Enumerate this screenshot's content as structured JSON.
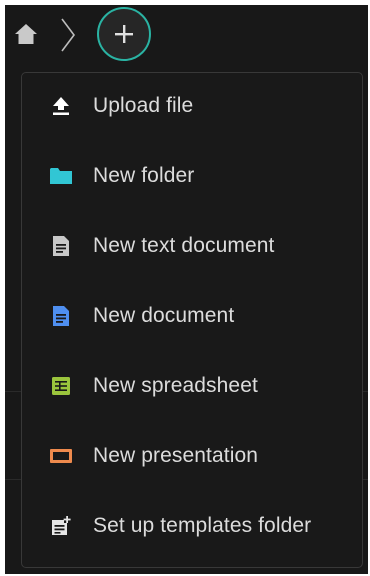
{
  "colors": {
    "accent": "#2ab3a3",
    "folder": "#31c6d4",
    "text_doc": "#c8c8c8",
    "document": "#4f8ff0",
    "spreadsheet": "#9bc53d",
    "presentation": "#ee8a4d"
  },
  "breadcrumb": {
    "home_icon": "home-icon",
    "separator_icon": "chevron-right-icon",
    "add_icon": "plus-icon"
  },
  "menu": {
    "items": [
      {
        "label": "Upload file",
        "icon": "upload-icon"
      },
      {
        "label": "New folder",
        "icon": "folder-icon"
      },
      {
        "label": "New text document",
        "icon": "text-document-icon"
      },
      {
        "label": "New document",
        "icon": "document-icon"
      },
      {
        "label": "New spreadsheet",
        "icon": "spreadsheet-icon"
      },
      {
        "label": "New presentation",
        "icon": "presentation-icon"
      },
      {
        "label": "Set up templates folder",
        "icon": "templates-folder-icon"
      }
    ]
  }
}
